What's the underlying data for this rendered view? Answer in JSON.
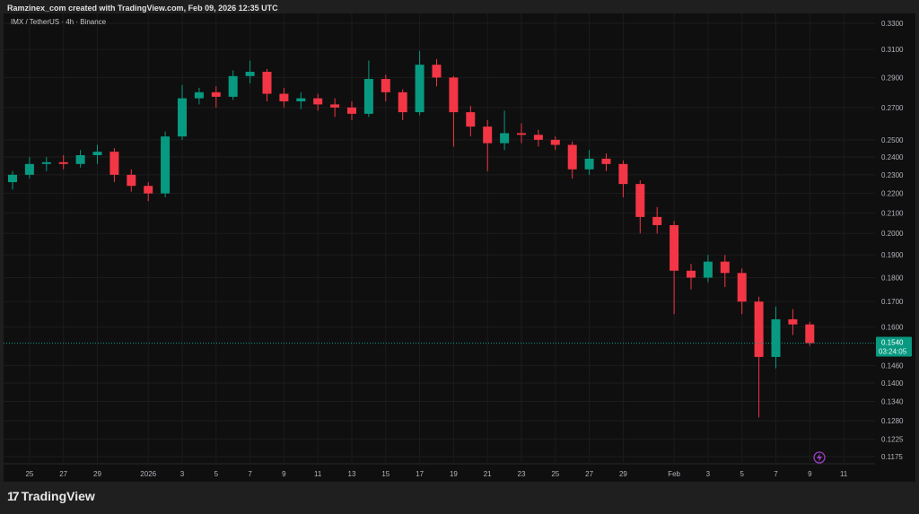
{
  "header": {
    "caption": "Ramzinex_com created with TradingView.com, Feb 09, 2026 12:35 UTC"
  },
  "symbol": {
    "label": "IMX / TetherUS · 4h · Binance"
  },
  "branding": {
    "name": "TradingView"
  },
  "price_label": {
    "price": "0.1540",
    "countdown": "03:24:05"
  },
  "icons": {
    "alert": "lightning-icon"
  },
  "colors": {
    "up": "#089981",
    "down": "#f23645",
    "price_line": "#089981",
    "bg": "#0f0f0f",
    "grid": "#1c1c1c",
    "alert": "#9c3fc4"
  },
  "chart_data": {
    "type": "candlestick",
    "title": "IMX / TetherUS · 4h · Binance",
    "scale": "log",
    "ylim": [
      0.1175,
      0.33
    ],
    "y_ticks": [
      "0.3300",
      "0.3100",
      "0.2900",
      "0.2700",
      "0.2500",
      "0.2400",
      "0.2300",
      "0.2200",
      "0.2100",
      "0.2000",
      "0.1900",
      "0.1800",
      "0.1700",
      "0.1600",
      "0.1460",
      "0.1400",
      "0.1340",
      "0.1280",
      "0.1225",
      "0.1175"
    ],
    "x_ticks": [
      [
        "25",
        1
      ],
      [
        "27",
        3
      ],
      [
        "29",
        5
      ],
      [
        "2026",
        8
      ],
      [
        "3",
        10
      ],
      [
        "5",
        12
      ],
      [
        "7",
        14
      ],
      [
        "9",
        16
      ],
      [
        "11",
        18
      ],
      [
        "13",
        20
      ],
      [
        "15",
        22
      ],
      [
        "17",
        24
      ],
      [
        "19",
        26
      ],
      [
        "21",
        28
      ],
      [
        "23",
        30
      ],
      [
        "25",
        32
      ],
      [
        "27",
        34
      ],
      [
        "29",
        36
      ],
      [
        "Feb",
        39
      ],
      [
        "3",
        41
      ],
      [
        "5",
        43
      ],
      [
        "7",
        45
      ],
      [
        "9",
        47
      ],
      [
        "11",
        49
      ]
    ],
    "last_price": 0.154,
    "candles": [
      [
        0.226,
        0.232,
        0.222,
        0.23
      ],
      [
        0.23,
        0.24,
        0.228,
        0.236
      ],
      [
        0.236,
        0.24,
        0.232,
        0.237
      ],
      [
        0.237,
        0.241,
        0.233,
        0.236
      ],
      [
        0.236,
        0.244,
        0.234,
        0.241
      ],
      [
        0.241,
        0.247,
        0.236,
        0.243
      ],
      [
        0.243,
        0.245,
        0.226,
        0.23
      ],
      [
        0.23,
        0.233,
        0.221,
        0.224
      ],
      [
        0.224,
        0.226,
        0.216,
        0.22
      ],
      [
        0.22,
        0.255,
        0.218,
        0.252
      ],
      [
        0.252,
        0.285,
        0.25,
        0.276
      ],
      [
        0.276,
        0.283,
        0.272,
        0.28
      ],
      [
        0.28,
        0.284,
        0.27,
        0.277
      ],
      [
        0.277,
        0.295,
        0.275,
        0.291
      ],
      [
        0.291,
        0.302,
        0.286,
        0.294
      ],
      [
        0.294,
        0.296,
        0.274,
        0.279
      ],
      [
        0.279,
        0.283,
        0.27,
        0.274
      ],
      [
        0.274,
        0.28,
        0.269,
        0.276
      ],
      [
        0.276,
        0.279,
        0.268,
        0.272
      ],
      [
        0.272,
        0.276,
        0.264,
        0.27
      ],
      [
        0.27,
        0.274,
        0.262,
        0.266
      ],
      [
        0.266,
        0.302,
        0.264,
        0.289
      ],
      [
        0.289,
        0.292,
        0.274,
        0.28
      ],
      [
        0.28,
        0.282,
        0.262,
        0.267
      ],
      [
        0.267,
        0.309,
        0.265,
        0.299
      ],
      [
        0.299,
        0.303,
        0.284,
        0.29
      ],
      [
        0.29,
        0.291,
        0.246,
        0.267
      ],
      [
        0.267,
        0.271,
        0.252,
        0.258
      ],
      [
        0.258,
        0.262,
        0.232,
        0.248
      ],
      [
        0.248,
        0.268,
        0.244,
        0.254
      ],
      [
        0.254,
        0.26,
        0.248,
        0.253
      ],
      [
        0.253,
        0.256,
        0.246,
        0.25
      ],
      [
        0.25,
        0.252,
        0.244,
        0.247
      ],
      [
        0.247,
        0.249,
        0.228,
        0.233
      ],
      [
        0.233,
        0.244,
        0.23,
        0.239
      ],
      [
        0.239,
        0.242,
        0.232,
        0.236
      ],
      [
        0.236,
        0.238,
        0.218,
        0.225
      ],
      [
        0.225,
        0.227,
        0.2,
        0.208
      ],
      [
        0.208,
        0.213,
        0.2,
        0.204
      ],
      [
        0.204,
        0.206,
        0.165,
        0.183
      ],
      [
        0.183,
        0.186,
        0.175,
        0.18
      ],
      [
        0.18,
        0.19,
        0.178,
        0.187
      ],
      [
        0.187,
        0.19,
        0.176,
        0.182
      ],
      [
        0.182,
        0.184,
        0.165,
        0.17
      ],
      [
        0.17,
        0.172,
        0.129,
        0.149
      ],
      [
        0.149,
        0.168,
        0.145,
        0.163
      ],
      [
        0.163,
        0.167,
        0.157,
        0.161
      ],
      [
        0.161,
        0.162,
        0.153,
        0.154
      ]
    ]
  }
}
